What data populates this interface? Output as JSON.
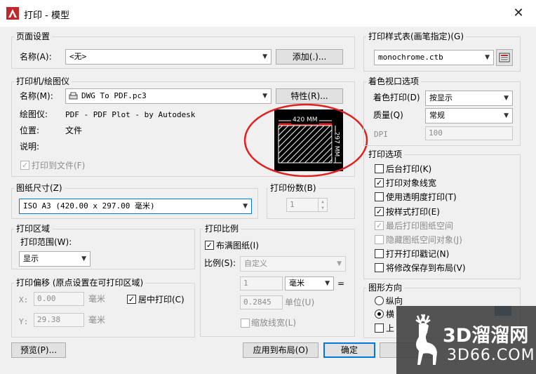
{
  "window": {
    "title": "打印 - 模型",
    "close_glyph": "✕"
  },
  "page_setup": {
    "group_label": "页面设置",
    "name_label": "名称(A):",
    "name_value": "<无>",
    "add_button": "添加(.)..."
  },
  "printer": {
    "group_label": "打印机/绘图仪",
    "name_label": "名称(M):",
    "name_value": "DWG To PDF.pc3",
    "properties_button": "特性(R)...",
    "plotter_label": "绘图仪:",
    "plotter_value": "PDF - PDF Plot - by Autodesk",
    "location_label": "位置:",
    "location_value": "文件",
    "description_label": "说明:",
    "plot_to_file_label": "打印到文件(F)",
    "plot_to_file_checked": true,
    "preview": {
      "width_label": "420 MM",
      "height_label": "297 MM"
    }
  },
  "paper_size": {
    "group_label": "图纸尺寸(Z)",
    "value": "ISO A3 (420.00 x 297.00 毫米)"
  },
  "copies": {
    "group_label": "打印份数(B)",
    "value": "1"
  },
  "plot_area": {
    "group_label": "打印区域",
    "range_label": "打印范围(W):",
    "range_value": "显示"
  },
  "plot_offset": {
    "group_label": "打印偏移 (原点设置在可打印区域)",
    "x_label": "X:",
    "x_value": "0.00",
    "x_unit": "毫米",
    "y_label": "Y:",
    "y_value": "29.38",
    "y_unit": "毫米",
    "center_label": "居中打印(C)",
    "center_checked": true
  },
  "plot_scale": {
    "group_label": "打印比例",
    "fit_label": "布满图纸(I)",
    "fit_checked": true,
    "scale_label": "比例(S):",
    "scale_value": "自定义",
    "value1": "1",
    "unit_value": "毫米",
    "equals": "=",
    "value2": "0.2845",
    "unit2_label": "单位(U)",
    "lineweights_label": "缩放线宽(L)",
    "lineweights_checked": false
  },
  "style_table": {
    "group_label": "打印样式表(画笔指定)(G)",
    "value": "monochrome.ctb",
    "edit_icon": "plot-style-editor-icon"
  },
  "shaded_viewport": {
    "group_label": "着色视口选项",
    "shade_label": "着色打印(D)",
    "shade_value": "按显示",
    "quality_label": "质量(Q)",
    "quality_value": "常规",
    "dpi_label": "DPI",
    "dpi_value": "100"
  },
  "plot_options": {
    "group_label": "打印选项",
    "items": [
      {
        "label": "后台打印(K)",
        "checked": false,
        "disabled": false
      },
      {
        "label": "打印对象线宽",
        "checked": true,
        "disabled": false
      },
      {
        "label": "使用透明度打印(T)",
        "checked": false,
        "disabled": false
      },
      {
        "label": "按样式打印(E)",
        "checked": true,
        "disabled": false
      },
      {
        "label": "最后打印图纸空间",
        "checked": true,
        "disabled": true
      },
      {
        "label": "隐藏图纸空间对象(J)",
        "checked": false,
        "disabled": true
      },
      {
        "label": "打开打印戳记(N)",
        "checked": false,
        "disabled": false
      },
      {
        "label": "将修改保存到布局(V)",
        "checked": false,
        "disabled": false
      }
    ]
  },
  "orientation": {
    "group_label": "图形方向",
    "portrait_label": "纵向",
    "landscape_label": "横",
    "upside_label": "上",
    "selected": "landscape"
  },
  "footer": {
    "preview_button": "预览(P)...",
    "apply_button": "应用到布局(O)",
    "ok_button": "确定"
  },
  "watermark": {
    "brand": "3D溜溜网",
    "url": "3D66.COM"
  },
  "colors": {
    "accent": "#0078d7",
    "annotation_red": "#e02020",
    "app_red": "#c1272d"
  }
}
